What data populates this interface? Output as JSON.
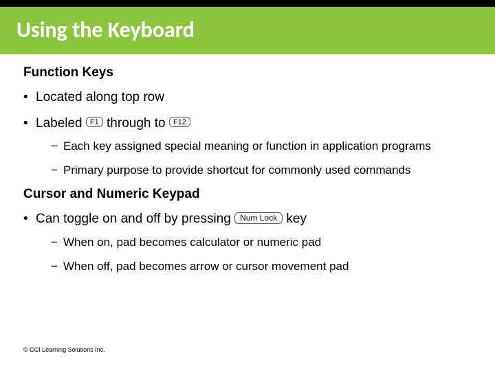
{
  "title": "Using the Keyboard",
  "section1": {
    "heading": "Function Keys",
    "bullets": {
      "b1": "Located along  top row",
      "b2_prefix": "Labeled ",
      "b2_mid": " through to ",
      "key_f1": "F1",
      "key_f12": "F12",
      "sub1": "Each key assigned special meaning or function in application programs",
      "sub2": "Primary purpose to provide shortcut for commonly used commands"
    }
  },
  "section2": {
    "heading": "Cursor and Numeric Keypad",
    "bullets": {
      "b1_prefix": "Can toggle on and off by pressing ",
      "b1_suffix": "  key",
      "key_numlock": "Num Lock",
      "sub1": "When on, pad becomes calculator or numeric pad",
      "sub2": "When off, pad becomes arrow or cursor movement pad"
    }
  },
  "footer": "© CCI Learning Solutions Inc."
}
